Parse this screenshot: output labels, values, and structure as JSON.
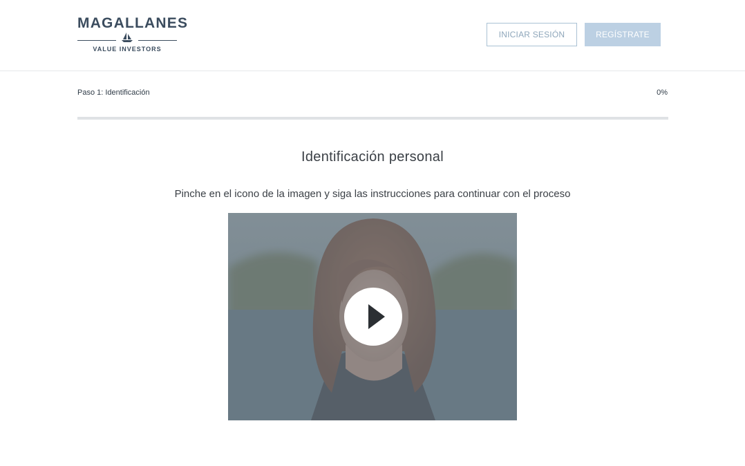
{
  "header": {
    "logo_title": "MAGALLANES",
    "logo_subtitle": "VALUE INVESTORS",
    "login_label": "INICIAR SESIÓN",
    "register_label": "REGÍSTRATE"
  },
  "progress": {
    "step_label": "Paso 1: Identificación",
    "percent_label": "0%",
    "value": 0
  },
  "main": {
    "heading": "Identificación personal",
    "instructions": "Pinche en el icono de la imagen y siga las instrucciones para continuar con el proceso"
  },
  "video": {
    "play_icon": "play-icon",
    "thumbnail": "portrait of woman with shoulder-length auburn hair"
  },
  "colors": {
    "brand": "#3b4c5e",
    "button_outline": "#a9c1d4",
    "button_fill": "#bcd0e3",
    "text": "#3a3f45"
  }
}
